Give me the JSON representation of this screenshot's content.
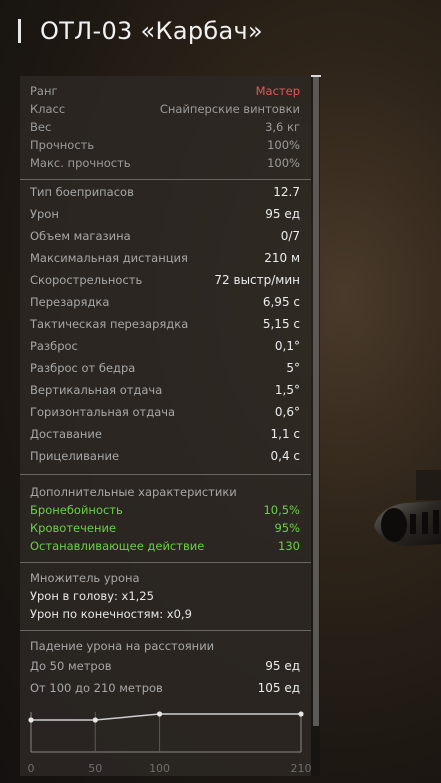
{
  "header": {
    "title": "ОТЛ-03 «Карбач»"
  },
  "base": [
    {
      "label": "Ранг",
      "value": "Мастер"
    },
    {
      "label": "Класс",
      "value": "Снайперские винтовки"
    },
    {
      "label": "Вес",
      "value": "3,6 кг"
    },
    {
      "label": "Прочность",
      "value": "100%"
    },
    {
      "label": "Макс. прочность",
      "value": "100%"
    }
  ],
  "stats": [
    {
      "label": "Тип боеприпасов",
      "value": "12.7"
    },
    {
      "label": "Урон",
      "value": "95 ед"
    },
    {
      "label": "Объем магазина",
      "value": "0/7"
    },
    {
      "label": "Максимальная дистанция",
      "value": "210 м"
    },
    {
      "label": "Скорострельность",
      "value": "72 выстр/мин"
    },
    {
      "label": "Перезарядка",
      "value": "6,95 с"
    },
    {
      "label": "Тактическая перезарядка",
      "value": "5,15 с"
    },
    {
      "label": "Разброс",
      "value": "0,1°"
    },
    {
      "label": "Разброс от бедра",
      "value": "5°"
    },
    {
      "label": "Вертикальная отдача",
      "value": "1,5°"
    },
    {
      "label": "Горизонтальная отдача",
      "value": "0,6°"
    },
    {
      "label": "Доставание",
      "value": "1,1 с"
    },
    {
      "label": "Прицеливание",
      "value": "0,4 с"
    }
  ],
  "extra": {
    "title": "Дополнительные характеристики",
    "items": [
      {
        "label": "Бронебойность",
        "value": "10,5%"
      },
      {
        "label": "Кровотечение",
        "value": "95%"
      },
      {
        "label": "Останавливающее действие",
        "value": "130"
      }
    ],
    "color": "#6ad146"
  },
  "multiplier": {
    "title": "Множитель урона",
    "head": "Урон в голову: x1,25",
    "limbs": "Урон по конечностям: x0,9"
  },
  "falloff": {
    "title": "Падение урона на расстоянии",
    "rows": [
      {
        "label": "До 50 метров",
        "value": "95 ед"
      },
      {
        "label": "От 100 до 210 метров",
        "value": "105 ед"
      }
    ]
  },
  "chart_data": {
    "type": "line",
    "x": [
      0,
      50,
      100,
      210
    ],
    "y": [
      95,
      95,
      105,
      105
    ],
    "tick_labels": [
      "0",
      "50",
      "100",
      "210"
    ],
    "xlim": [
      0,
      210
    ],
    "grid": true,
    "color": "#cfcfcf"
  },
  "colors": {
    "rank": "#e0585a",
    "accent_green": "#6ad146"
  }
}
